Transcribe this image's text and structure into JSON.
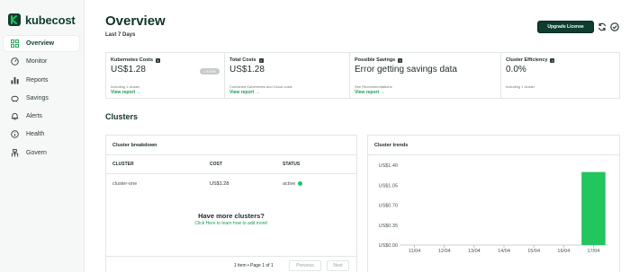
{
  "brand": {
    "name": "kubecost",
    "color": "#22c55e"
  },
  "sidebar": {
    "items": [
      {
        "label": "Overview",
        "icon": "grid-icon",
        "active": true
      },
      {
        "label": "Monitor",
        "icon": "gauge-icon"
      },
      {
        "label": "Reports",
        "icon": "bar-chart-icon"
      },
      {
        "label": "Savings",
        "icon": "piggy-bank-icon"
      },
      {
        "label": "Alerts",
        "icon": "bell-icon"
      },
      {
        "label": "Health",
        "icon": "info-circle-icon"
      },
      {
        "label": "Govern",
        "icon": "hierarchy-icon"
      }
    ]
  },
  "header": {
    "title": "Overview",
    "subtitle": "Last 7 Days",
    "upgrade_label": "Upgrade License",
    "refresh_icon": "refresh-icon",
    "check_icon": "check-circle-icon"
  },
  "kpis": [
    {
      "title": "Kubernetes Costs",
      "value": "US$1.28",
      "badge": "0.00%",
      "note": "Including 1 cluster",
      "link": "View report →"
    },
    {
      "title": "Total Costs",
      "value": "US$1.28",
      "note": "Combined Kubernetes and Cloud costs",
      "link": "View report →"
    },
    {
      "title": "Possible Savings",
      "value": "Error getting savings data",
      "note": "See Recommendations",
      "link": "View report →"
    },
    {
      "title": "Cluster Efficiency",
      "value": "0.0%",
      "note": "Including 1 cluster",
      "link": ""
    }
  ],
  "clusters": {
    "section_title": "Clusters",
    "breakdown": {
      "title": "Cluster breakdown",
      "columns": [
        "CLUSTER",
        "COST",
        "STATUS"
      ],
      "rows": [
        {
          "cluster": "cluster-one",
          "cost": "US$1.28",
          "status": "active"
        }
      ],
      "more_title": "Have more clusters?",
      "more_link": "Click Here to learn how to add more!",
      "pager_text": "1 item • Page 1 of 1",
      "prev_label": "Previous",
      "next_label": "Next"
    },
    "trends": {
      "title": "Cluster trends"
    }
  },
  "chart_data": {
    "type": "bar",
    "categories": [
      "11/04",
      "12/04",
      "13/04",
      "14/04",
      "15/04",
      "16/04",
      "17/04"
    ],
    "values": [
      0,
      0,
      0,
      0,
      0,
      0,
      1.28
    ],
    "yticks": [
      "US$0.00",
      "US$0.35",
      "US$0.70",
      "US$1.05",
      "US$1.40"
    ],
    "ylim": [
      0,
      1.4
    ],
    "grid": false,
    "color": "#22c55e"
  }
}
